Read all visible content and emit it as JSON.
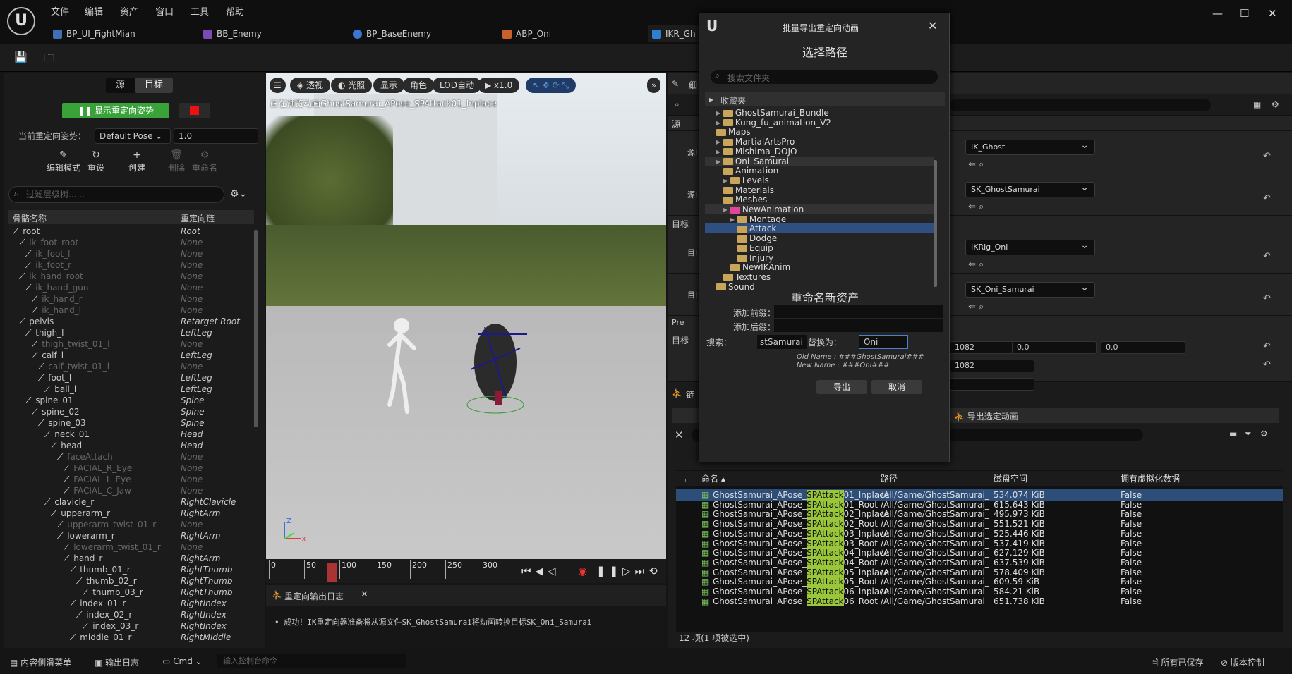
{
  "menu": [
    "文件",
    "编辑",
    "资产",
    "窗口",
    "工具",
    "帮助"
  ],
  "tabs": [
    "BP_UI_FightMian",
    "BB_Enemy",
    "BP_BaseEnemy",
    "ABP_Oni",
    "IKR_Gh"
  ],
  "left": {
    "seg": [
      "源",
      "目标"
    ],
    "show_pose_button": "显示重定向姿势",
    "current_pose_label": "当前重定向姿势：",
    "current_pose_value": "Default Pose",
    "pose_blend": "1.0",
    "tools": [
      "编辑模式",
      "重设",
      "创建",
      "删除",
      "重命名"
    ],
    "search_placeholder": "过滤层级树......",
    "col_name": "骨骼名称",
    "col_chain": "重定向链",
    "bones": [
      {
        "name": "root",
        "chain": "Root",
        "indent": 0,
        "dim": false
      },
      {
        "name": "ik_foot_root",
        "chain": "None",
        "indent": 1,
        "dim": true
      },
      {
        "name": "ik_foot_l",
        "chain": "None",
        "indent": 2,
        "dim": true
      },
      {
        "name": "ik_foot_r",
        "chain": "None",
        "indent": 2,
        "dim": true
      },
      {
        "name": "ik_hand_root",
        "chain": "None",
        "indent": 1,
        "dim": true
      },
      {
        "name": "ik_hand_gun",
        "chain": "None",
        "indent": 2,
        "dim": true
      },
      {
        "name": "ik_hand_r",
        "chain": "None",
        "indent": 3,
        "dim": true
      },
      {
        "name": "ik_hand_l",
        "chain": "None",
        "indent": 3,
        "dim": true
      },
      {
        "name": "pelvis",
        "chain": "Retarget Root",
        "indent": 1,
        "dim": false
      },
      {
        "name": "thigh_l",
        "chain": "LeftLeg",
        "indent": 2,
        "dim": false
      },
      {
        "name": "thigh_twist_01_l",
        "chain": "None",
        "indent": 3,
        "dim": true
      },
      {
        "name": "calf_l",
        "chain": "LeftLeg",
        "indent": 3,
        "dim": false
      },
      {
        "name": "calf_twist_01_l",
        "chain": "None",
        "indent": 4,
        "dim": true
      },
      {
        "name": "foot_l",
        "chain": "LeftLeg",
        "indent": 4,
        "dim": false
      },
      {
        "name": "ball_l",
        "chain": "LeftLeg",
        "indent": 5,
        "dim": false
      },
      {
        "name": "spine_01",
        "chain": "Spine",
        "indent": 2,
        "dim": false
      },
      {
        "name": "spine_02",
        "chain": "Spine",
        "indent": 3,
        "dim": false
      },
      {
        "name": "spine_03",
        "chain": "Spine",
        "indent": 4,
        "dim": false
      },
      {
        "name": "neck_01",
        "chain": "Head",
        "indent": 5,
        "dim": false
      },
      {
        "name": "head",
        "chain": "Head",
        "indent": 6,
        "dim": false
      },
      {
        "name": "faceAttach",
        "chain": "None",
        "indent": 7,
        "dim": true
      },
      {
        "name": "FACIAL_R_Eye",
        "chain": "None",
        "indent": 8,
        "dim": true
      },
      {
        "name": "FACIAL_L_Eye",
        "chain": "None",
        "indent": 8,
        "dim": true
      },
      {
        "name": "FACIAL_C_Jaw",
        "chain": "None",
        "indent": 8,
        "dim": true
      },
      {
        "name": "clavicle_r",
        "chain": "RightClavicle",
        "indent": 5,
        "dim": false
      },
      {
        "name": "upperarm_r",
        "chain": "RightArm",
        "indent": 6,
        "dim": false
      },
      {
        "name": "upperarm_twist_01_r",
        "chain": "None",
        "indent": 7,
        "dim": true
      },
      {
        "name": "lowerarm_r",
        "chain": "RightArm",
        "indent": 7,
        "dim": false
      },
      {
        "name": "lowerarm_twist_01_r",
        "chain": "None",
        "indent": 8,
        "dim": true
      },
      {
        "name": "hand_r",
        "chain": "RightArm",
        "indent": 8,
        "dim": false
      },
      {
        "name": "thumb_01_r",
        "chain": "RightThumb",
        "indent": 9,
        "dim": false
      },
      {
        "name": "thumb_02_r",
        "chain": "RightThumb",
        "indent": 10,
        "dim": false
      },
      {
        "name": "thumb_03_r",
        "chain": "RightThumb",
        "indent": 11,
        "dim": false
      },
      {
        "name": "index_01_r",
        "chain": "RightIndex",
        "indent": 9,
        "dim": false
      },
      {
        "name": "index_02_r",
        "chain": "RightIndex",
        "indent": 10,
        "dim": false
      },
      {
        "name": "index_03_r",
        "chain": "RightIndex",
        "indent": 11,
        "dim": false
      },
      {
        "name": "middle_01_r",
        "chain": "RightMiddle",
        "indent": 9,
        "dim": false
      }
    ]
  },
  "viewport": {
    "buttons": [
      "透视",
      "光照",
      "显示",
      "角色",
      "LOD自动",
      "x1.0"
    ],
    "message": "正在预览动画GhostSamurai_APose_SPAttack01_Inplace",
    "timeline_ticks": [
      "0",
      "50",
      "100",
      "150",
      "200",
      "250",
      "300"
    ]
  },
  "log": {
    "tab": "重定向输出日志",
    "line": "成功！IK重定向器准备将从源文件SK_GhostSamurai将动画转换目标SK_Oni_Samurai"
  },
  "details": {
    "dropdowns": [
      "IK_Ghost",
      "SK_GhostSamurai",
      "IKRig_Oni",
      "SK_Oni_Samurai"
    ],
    "side_labels": [
      "细",
      "源",
      "源I",
      "源I",
      "目标",
      "目I",
      "目I",
      "Pre",
      "目标",
      "链"
    ],
    "vals": [
      "1082",
      "0.0",
      "0.0",
      "1082"
    ],
    "export_selected": "导出选定动画"
  },
  "assets": {
    "cols": [
      "命名",
      "路径",
      "磁盘空间",
      "拥有虚拟化数据"
    ],
    "rows": [
      {
        "pre": "GhostSamurai_APose_",
        "hl": "SPAttack",
        "post": "01_Inplace",
        "path": "/All/Game/GhostSamurai_",
        "size": "534.074 KiB",
        "virt": "False"
      },
      {
        "pre": "GhostSamurai_APose_",
        "hl": "SPAttack",
        "post": "01_Root",
        "path": "/All/Game/GhostSamurai_",
        "size": "615.643 KiB",
        "virt": "False"
      },
      {
        "pre": "GhostSamurai_APose_",
        "hl": "SPAttack",
        "post": "02_Inplace",
        "path": "/All/Game/GhostSamurai_",
        "size": "495.973 KiB",
        "virt": "False"
      },
      {
        "pre": "GhostSamurai_APose_",
        "hl": "SPAttack",
        "post": "02_Root",
        "path": "/All/Game/GhostSamurai_",
        "size": "551.521 KiB",
        "virt": "False"
      },
      {
        "pre": "GhostSamurai_APose_",
        "hl": "SPAttack",
        "post": "03_Inplace",
        "path": "/All/Game/GhostSamurai_",
        "size": "525.446 KiB",
        "virt": "False"
      },
      {
        "pre": "GhostSamurai_APose_",
        "hl": "SPAttack",
        "post": "03_Root",
        "path": "/All/Game/GhostSamurai_",
        "size": "537.419 KiB",
        "virt": "False"
      },
      {
        "pre": "GhostSamurai_APose_",
        "hl": "SPAttack",
        "post": "04_Inplace",
        "path": "/All/Game/GhostSamurai_",
        "size": "627.129 KiB",
        "virt": "False"
      },
      {
        "pre": "GhostSamurai_APose_",
        "hl": "SPAttack",
        "post": "04_Root",
        "path": "/All/Game/GhostSamurai_",
        "size": "637.539 KiB",
        "virt": "False"
      },
      {
        "pre": "GhostSamurai_APose_",
        "hl": "SPAttack",
        "post": "05_Inplace",
        "path": "/All/Game/GhostSamurai_",
        "size": "578.409 KiB",
        "virt": "False"
      },
      {
        "pre": "GhostSamurai_APose_",
        "hl": "SPAttack",
        "post": "05_Root",
        "path": "/All/Game/GhostSamurai_",
        "size": "609.59 KiB",
        "virt": "False"
      },
      {
        "pre": "GhostSamurai_APose_",
        "hl": "SPAttack",
        "post": "06_Inplace",
        "path": "/All/Game/GhostSamurai_",
        "size": "584.21 KiB",
        "virt": "False"
      },
      {
        "pre": "GhostSamurai_APose_",
        "hl": "SPAttack",
        "post": "06_Root",
        "path": "/All/Game/GhostSamurai_",
        "size": "651.738 KiB",
        "virt": "False"
      }
    ],
    "count": "12 项(1 项被选中)"
  },
  "dialog": {
    "title": "批量导出重定向动画",
    "section_path": "选择路径",
    "search_placeholder": "搜索文件夹",
    "favorites": "收藏夹",
    "folders": [
      {
        "name": "GhostSamurai_Bundle",
        "indent": 1,
        "arrow": true,
        "pink": false,
        "sel": false
      },
      {
        "name": "Kung_fu_animation_V2",
        "indent": 1,
        "arrow": true,
        "pink": false,
        "sel": false
      },
      {
        "name": "Maps",
        "indent": 1,
        "arrow": false,
        "pink": false,
        "sel": false
      },
      {
        "name": "MartialArtsPro",
        "indent": 1,
        "arrow": true,
        "pink": false,
        "sel": false
      },
      {
        "name": "Mishima_DOJO",
        "indent": 1,
        "arrow": true,
        "pink": false,
        "sel": false
      },
      {
        "name": "Oni_Samurai",
        "indent": 1,
        "arrow": true,
        "pink": false,
        "sel": false,
        "row": true
      },
      {
        "name": "Animation",
        "indent": 2,
        "arrow": false,
        "pink": false,
        "sel": false
      },
      {
        "name": "Levels",
        "indent": 2,
        "arrow": true,
        "pink": false,
        "sel": false
      },
      {
        "name": "Materials",
        "indent": 2,
        "arrow": false,
        "pink": false,
        "sel": false
      },
      {
        "name": "Meshes",
        "indent": 2,
        "arrow": false,
        "pink": false,
        "sel": false
      },
      {
        "name": "NewAnimation",
        "indent": 2,
        "arrow": true,
        "pink": true,
        "sel": false,
        "row": true
      },
      {
        "name": "Montage",
        "indent": 3,
        "arrow": true,
        "pink": false,
        "sel": false
      },
      {
        "name": "Attack",
        "indent": 4,
        "arrow": false,
        "pink": false,
        "sel": true
      },
      {
        "name": "Dodge",
        "indent": 4,
        "arrow": false,
        "pink": false,
        "sel": false
      },
      {
        "name": "Equip",
        "indent": 4,
        "arrow": false,
        "pink": false,
        "sel": false
      },
      {
        "name": "Injury",
        "indent": 4,
        "arrow": false,
        "pink": false,
        "sel": false
      },
      {
        "name": "NewIKAnim",
        "indent": 3,
        "arrow": false,
        "pink": false,
        "sel": false
      },
      {
        "name": "Textures",
        "indent": 2,
        "arrow": false,
        "pink": false,
        "sel": false
      },
      {
        "name": "Sound",
        "indent": 1,
        "arrow": false,
        "pink": false,
        "sel": false
      }
    ],
    "section_rename": "重命名新资产",
    "prefix_label": "添加前缀：",
    "suffix_label": "添加后缀：",
    "search_label": "搜索：",
    "search_value": "stSamurai",
    "replace_label": "替换为：",
    "replace_value": "Oni",
    "old_name": "Old Name : ###GhostSamurai###",
    "new_name": "New Name : ###Oni###",
    "export_button": "导出",
    "cancel_button": "取消"
  },
  "statusbar": {
    "content_drawer": "内容侧滑菜单",
    "output_log": "输出日志",
    "cmd": "Cmd",
    "console_placeholder": "输入控制台命令",
    "all_saved": "所有已保存",
    "source_control": "版本控制"
  }
}
